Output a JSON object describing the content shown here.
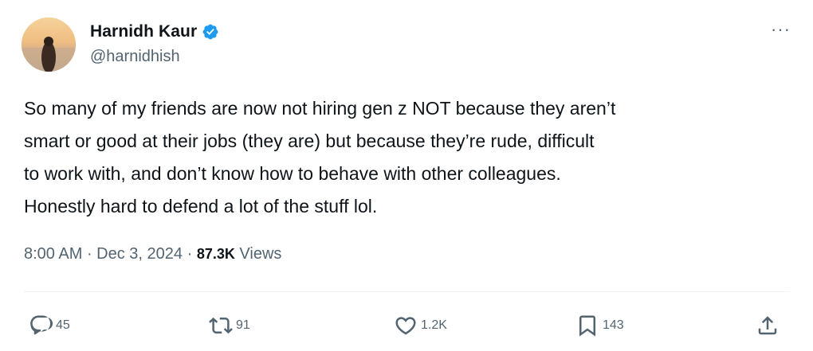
{
  "author": {
    "display_name": "Harnidh Kaur",
    "handle": "@harnidhish",
    "verified": true,
    "avatar": "profile-photo"
  },
  "more_menu": {
    "label": "···"
  },
  "tweet": {
    "lines": [
      "So many of my friends are now not hiring gen z NOT because they aren’t",
      "smart or good at their jobs (they are) but because they’re rude, difficult",
      "to work with, and don’t know how to behave with other colleagues.",
      "Honestly hard to defend a lot of the stuff lol."
    ]
  },
  "meta": {
    "time": "8:00 AM",
    "separator": " · ",
    "date": "Dec 3, 2024",
    "views_count": "87.3K",
    "views_label": " Views"
  },
  "actions": {
    "replies": {
      "icon": "reply-icon",
      "count": "45"
    },
    "reposts": {
      "icon": "retweet-icon",
      "count": "91"
    },
    "likes": {
      "icon": "heart-icon",
      "count": "1.2K"
    },
    "bookmarks": {
      "icon": "bookmark-icon",
      "count": "143"
    },
    "share": {
      "icon": "share-icon"
    }
  },
  "colors": {
    "text_primary": "#0f1419",
    "text_secondary": "#536471",
    "verified_blue": "#1d9bf0",
    "divider": "#eff3f4"
  }
}
